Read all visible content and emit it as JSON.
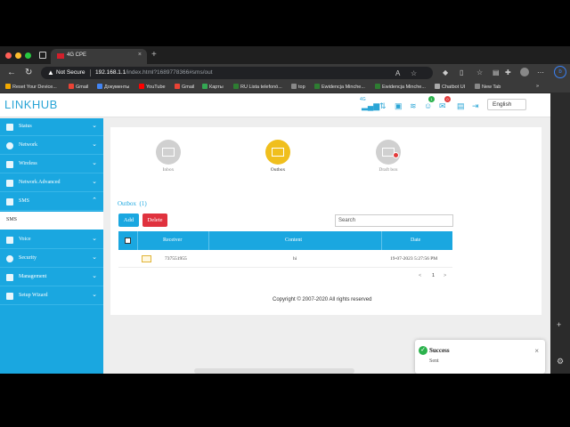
{
  "browser": {
    "tab_title": "4G CPE",
    "new_tab": "+",
    "security_label": "Not Secure",
    "url_host": "192.168.1.1",
    "url_path": "/index.html?1689778366#sms/out"
  },
  "bookmarks": [
    {
      "label": "Reset Your Device...",
      "color": "#f2a900"
    },
    {
      "label": "Gmail",
      "color": "#ea4335"
    },
    {
      "label": "Документы",
      "color": "#4285f4"
    },
    {
      "label": "YouTube",
      "color": "#ff0000"
    },
    {
      "label": "Gmail",
      "color": "#ea4335"
    },
    {
      "label": "Карты",
      "color": "#34a853"
    },
    {
      "label": "RU Lista telefonó...",
      "color": "#2e7d32"
    },
    {
      "label": "top",
      "color": "#888888"
    },
    {
      "label": "Ewidencja Minche...",
      "color": "#2e7d32"
    },
    {
      "label": "Ewidencja Minche...",
      "color": "#2e7d32"
    },
    {
      "label": "Chatbot UI",
      "color": "#aaaaaa"
    },
    {
      "label": "New Tab",
      "color": "#888888"
    }
  ],
  "header": {
    "logo_a": "LINK",
    "logo_b": "HUB",
    "network_label": "4G",
    "badge_1": "1",
    "badge_2": "0",
    "language": "English"
  },
  "sidebar": {
    "items": [
      {
        "label": "Status"
      },
      {
        "label": "Network"
      },
      {
        "label": "Wireless"
      },
      {
        "label": "Network Advanced"
      },
      {
        "label": "SMS"
      },
      {
        "label": "SMS",
        "sub": true
      },
      {
        "label": "Voice"
      },
      {
        "label": "Security"
      },
      {
        "label": "Management"
      },
      {
        "label": "Setup Wizard"
      }
    ]
  },
  "sms": {
    "boxes": [
      {
        "label": "Inbox"
      },
      {
        "label": "Outbox"
      },
      {
        "label": "Draft box"
      }
    ],
    "outbox_title": "Outbox  (1)",
    "add_label": "Add",
    "delete_label": "Delete",
    "search_placeholder": "Search",
    "columns": [
      "Receiver",
      "Content",
      "Date"
    ],
    "rows": [
      {
        "receiver": "737551955",
        "content": "hi",
        "date": "19-07-2023 5:27:56 PM"
      }
    ],
    "page_prev": "<",
    "page_num": "1",
    "page_next": ">",
    "footer": "Copyright © 2007-2020 All rights reserved"
  },
  "toast": {
    "title": "Success",
    "message": "Sent",
    "close": "×"
  },
  "colors": {
    "accent": "#1aa7e0",
    "active_box": "#f0bf1d",
    "delete": "#e0323e",
    "success": "#2bb24c"
  }
}
